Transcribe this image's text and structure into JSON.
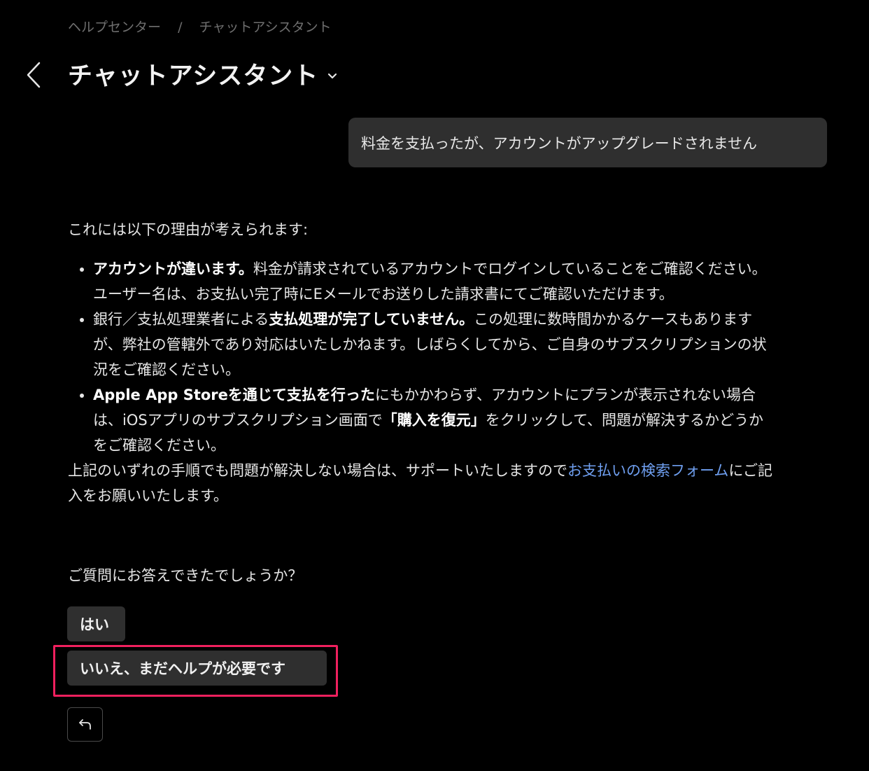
{
  "breadcrumb": {
    "home": "ヘルプセンター",
    "separator": "/",
    "current": "チャットアシスタント"
  },
  "header": {
    "title": "チャットアシスタント",
    "back_icon": "chevron-left-icon",
    "dropdown_icon": "chevron-down-icon"
  },
  "user_message": "料金を支払ったが、アカウントがアップグレードされません",
  "assistant": {
    "intro": "これには以下の理由が考えられます:",
    "bullets": [
      {
        "bold": "アカウントが違います。",
        "text": "料金が請求されているアカウントでログインしていることをご確認ください。ユーザー名は、お支払い完了時にEメールでお送りした請求書にてご確認いただけます。"
      },
      {
        "pre": "銀行／支払処理業者による",
        "bold": "支払処理が完了していません。",
        "text": "この処理に数時間かかるケースもありますが、弊社の管轄外であり対応はいたしかねます。しばらくしてから、ご自身のサブスクリプションの状況をご確認ください。"
      },
      {
        "bold": "Apple App Storeを通じて支払を行った",
        "text": "にもかかわらず、アカウントにプランが表示されない場合は、iOSアプリのサブスクリプション画面で",
        "bold2": "「購入を復元」",
        "text2": "をクリックして、問題が解決するかどうかをご確認ください。"
      }
    ],
    "outro_pre": "上記のいずれの手順でも問題が解決しない場合は、サポートいたしますので",
    "outro_link": "お支払いの検索フォーム",
    "outro_post": "にご記入をお願いいたします。"
  },
  "question": "ご質問にお答えできたでしょうか？",
  "options": {
    "yes": "はい",
    "no": "いいえ、まだヘルプが必要です"
  },
  "undo_icon": "undo-arrow-icon",
  "colors": {
    "background": "#000000",
    "bubble": "#2f2f2f",
    "link": "#6f9ff0",
    "highlight": "#f0205e",
    "muted": "#6f6f6f"
  }
}
